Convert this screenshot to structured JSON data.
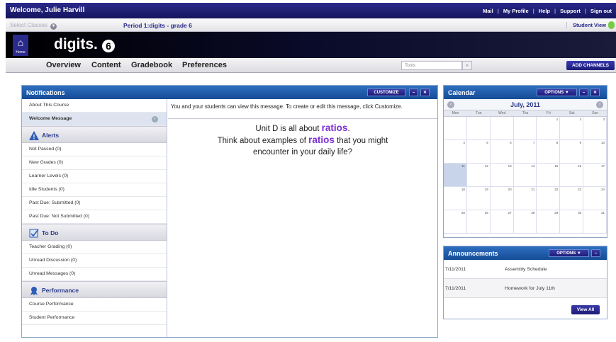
{
  "topbar": {
    "welcome": "Welcome, Julie Harvill",
    "links": [
      "Mail",
      "My Profile",
      "Help",
      "Support",
      "Sign out"
    ]
  },
  "classbar": {
    "select_classes": "Select Classes",
    "period": "Period 1:digits - grade 6",
    "student_view": "Student View"
  },
  "banner": {
    "home_label": "Home",
    "logo": "digits.",
    "grade": "6"
  },
  "tabs": {
    "items": [
      "Overview",
      "Content",
      "Gradebook",
      "Preferences"
    ],
    "tools_placeholder": "Tools",
    "add_channels": "ADD CHANNELS"
  },
  "notifications": {
    "title": "Notifications",
    "customize": "CUSTOMIZE",
    "about": "About This Course",
    "welcome": "Welcome Message",
    "alerts": {
      "title": "Alerts",
      "items": [
        "Not Passed (0)",
        "New Grades (0)",
        "Learner Levels (0)",
        "Idle Students (0)",
        "Past Due: Submitted (0)",
        "Past Due: Not Submitted (0)"
      ]
    },
    "todo": {
      "title": "To Do",
      "items": [
        "Teacher Grading (0)",
        "Unread Discussion (0)",
        "Unread Messages (0)"
      ]
    },
    "performance": {
      "title": "Performance",
      "items": [
        "Course Performance",
        "Student Performance"
      ]
    },
    "message_note": "You and your students can view this message. To create or edit this message, click Customize.",
    "line1_a": "Unit D is all about ",
    "line1_b": "ratios",
    "line1_c": ".",
    "line2_a": "Think about examples of ",
    "line2_b": "ratios",
    "line2_c": " that you might",
    "line3": "encounter in your daily life?"
  },
  "calendar": {
    "title": "Calendar",
    "options": "OPTIONS ▼",
    "month": "July, 2011",
    "days": [
      "Mon",
      "Tue",
      "Wed",
      "Thu",
      "Fri",
      "Sat",
      "Sun"
    ],
    "weeks": [
      [
        "",
        "",
        "",
        "",
        "1",
        "2",
        "3"
      ],
      [
        "4",
        "5",
        "6",
        "7",
        "8",
        "9",
        "10"
      ],
      [
        "11",
        "12",
        "13",
        "14",
        "15",
        "16",
        "17"
      ],
      [
        "18",
        "19",
        "20",
        "21",
        "22",
        "23",
        "24"
      ],
      [
        "25",
        "26",
        "27",
        "28",
        "29",
        "30",
        "31"
      ]
    ],
    "today": "11"
  },
  "announcements": {
    "title": "Announcements",
    "options": "OPTIONS ▼",
    "items": [
      {
        "date": "7/11/2011",
        "title": "Assembly Schedule"
      },
      {
        "date": "7/11/2011",
        "title": "Homework for July 11th"
      }
    ],
    "view_all": "View All"
  },
  "colors": {
    "accent": "#15155e",
    "header_blue": "#2e6ec0",
    "ratio_purple": "#7b2fd0"
  }
}
